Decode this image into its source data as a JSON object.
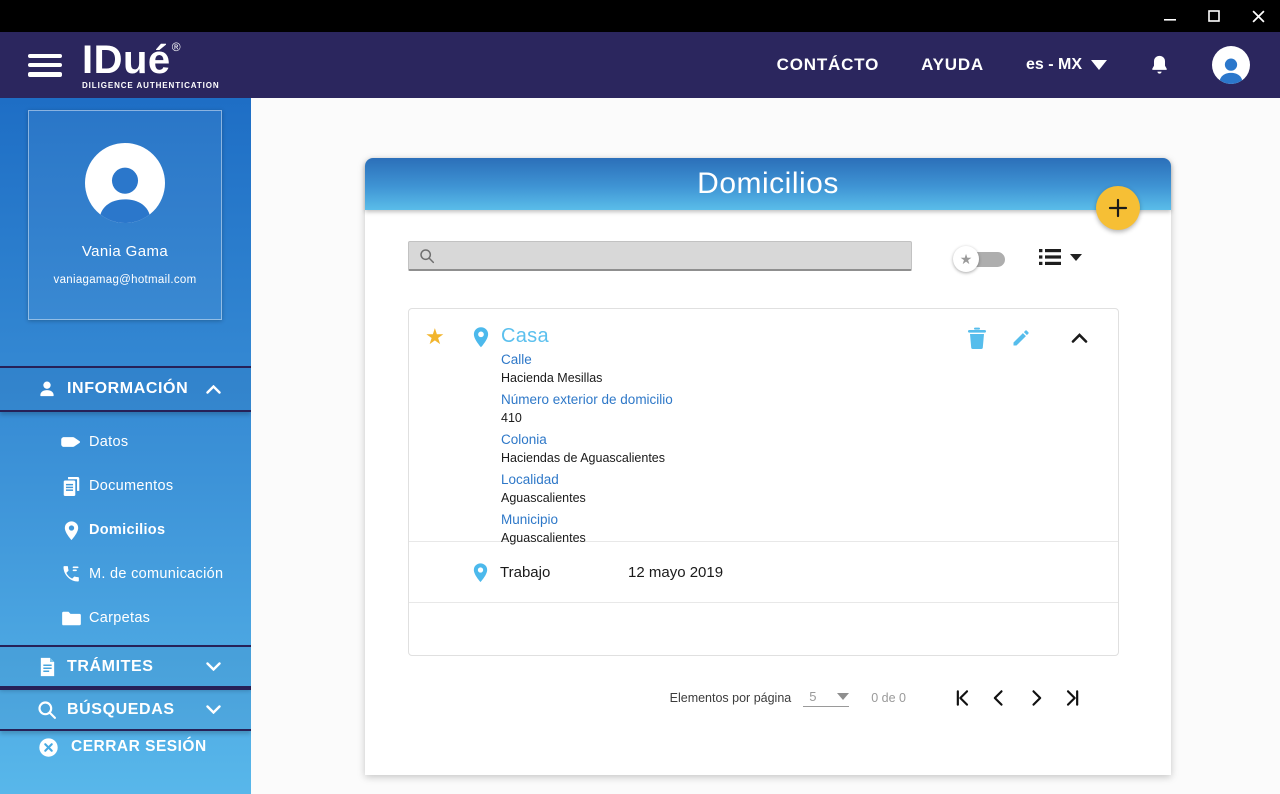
{
  "header": {
    "logo_title": "IDué",
    "logo_mark": "®",
    "logo_subtitle": "DILIGENCE AUTHENTICATION",
    "contact_label": "CONTÁCTO",
    "help_label": "AYUDA",
    "language": "es - MX"
  },
  "sidebar": {
    "profile": {
      "name": "Vania Gama",
      "email": "vaniagamag@hotmail.com"
    },
    "info_section": "INFORMACIÓN",
    "info_items": [
      {
        "label": "Datos"
      },
      {
        "label": "Documentos"
      },
      {
        "label": "Domicilios",
        "active": true
      },
      {
        "label": "M. de comunicación"
      },
      {
        "label": "Carpetas"
      }
    ],
    "tramites_section": "TRÁMITES",
    "busquedas_section": "BÚSQUEDAS",
    "logout_label": "CERRAR SESIÓN"
  },
  "main": {
    "card_title": "Domicilios",
    "search_value": "",
    "addresses": [
      {
        "name": "Casa",
        "favorite": true,
        "expanded": true,
        "fields": [
          {
            "label": "Calle",
            "value": "Hacienda Mesillas"
          },
          {
            "label": "Número exterior de domicilio",
            "value": "410"
          },
          {
            "label": "Colonia",
            "value": "Haciendas de Aguascalientes"
          },
          {
            "label": "Localidad",
            "value": "Aguascalientes"
          },
          {
            "label": "Municipio",
            "value": "Aguascalientes"
          }
        ]
      },
      {
        "name": "Trabajo",
        "date": "12 mayo 2019"
      }
    ],
    "pagination": {
      "items_per_page_label": "Elementos por página",
      "page_size": "5",
      "range_label": "0 de 0"
    }
  },
  "icons": {
    "star": "★",
    "menu": "hamburger",
    "bell": "notification-bell",
    "avatar": "person-circle",
    "pin": "map-pin",
    "trash": "trash-can",
    "edit": "pencil",
    "add": "plus",
    "collapse": "chevron-up",
    "expand": "chevron-down",
    "first_page": "|◀",
    "prev_page": "◀",
    "next_page": "▶",
    "last_page": "▶|"
  },
  "colors": {
    "titlebar": "#000000",
    "header_navy": "#2b265e",
    "sidebar_top": "#1e6ec5",
    "sidebar_bottom": "#58b7ea",
    "card_header_top": "#2b6fb9",
    "card_header_bottom": "#5abde9",
    "sky_blue": "#5bc0ee",
    "label_blue": "#2e78c8",
    "fab_yellow": "#f6bf35",
    "star_gold": "#f2b52d"
  }
}
